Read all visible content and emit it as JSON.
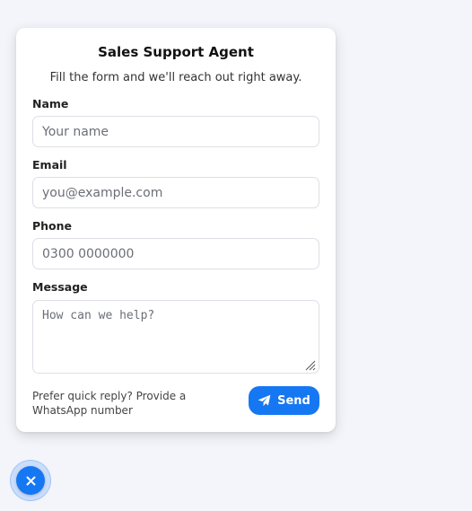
{
  "widget": {
    "title": "Sales Support Agent",
    "subtitle": "Fill the form and we'll reach out right away."
  },
  "form": {
    "name": {
      "label": "Name",
      "value": "",
      "placeholder": "Your name"
    },
    "email": {
      "label": "Email",
      "value": "",
      "placeholder": "you@example.com"
    },
    "phone": {
      "label": "Phone",
      "value": "",
      "placeholder": "0300 0000000"
    },
    "message": {
      "label": "Message",
      "value": "",
      "placeholder": "How can we help?"
    }
  },
  "footer": {
    "note": "Prefer quick reply? Provide a WhatsApp number",
    "send_label": "Send",
    "send_icon": "paper-plane-icon"
  },
  "launcher": {
    "icon": "close-icon"
  },
  "colors": {
    "accent": "#1677f2",
    "background": "#f3f5fa",
    "card": "#ffffff"
  }
}
